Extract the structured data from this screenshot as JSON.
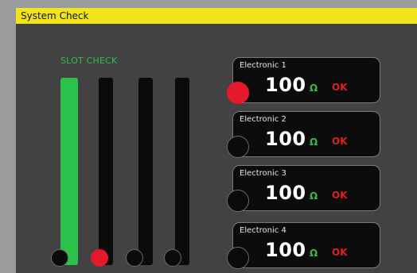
{
  "window": {
    "title": "System Check"
  },
  "slot_check": {
    "title": "SLOT CHECK",
    "slots": [
      {
        "name": "slot-1",
        "state": "active",
        "knob": "dark"
      },
      {
        "name": "slot-2",
        "state": "idle",
        "knob": "red"
      },
      {
        "name": "slot-3",
        "state": "idle",
        "knob": "dark"
      },
      {
        "name": "slot-4",
        "state": "idle",
        "knob": "dark"
      }
    ]
  },
  "electronics": [
    {
      "title": "Electronic 1",
      "value": "100",
      "unit": "Ω",
      "status": "OK",
      "indicator": "red"
    },
    {
      "title": "Electronic 2",
      "value": "100",
      "unit": "Ω",
      "status": "OK",
      "indicator": "dark"
    },
    {
      "title": "Electronic 3",
      "value": "100",
      "unit": "Ω",
      "status": "OK",
      "indicator": "dark"
    },
    {
      "title": "Electronic 4",
      "value": "100",
      "unit": "Ω",
      "status": "OK",
      "indicator": "dark"
    }
  ],
  "colors": {
    "title_bar": "#f0e51c",
    "active_slot": "#2ac24a",
    "indicator_red": "#e5192a",
    "unit_green": "#2fbe49",
    "status_red": "#e02020"
  }
}
